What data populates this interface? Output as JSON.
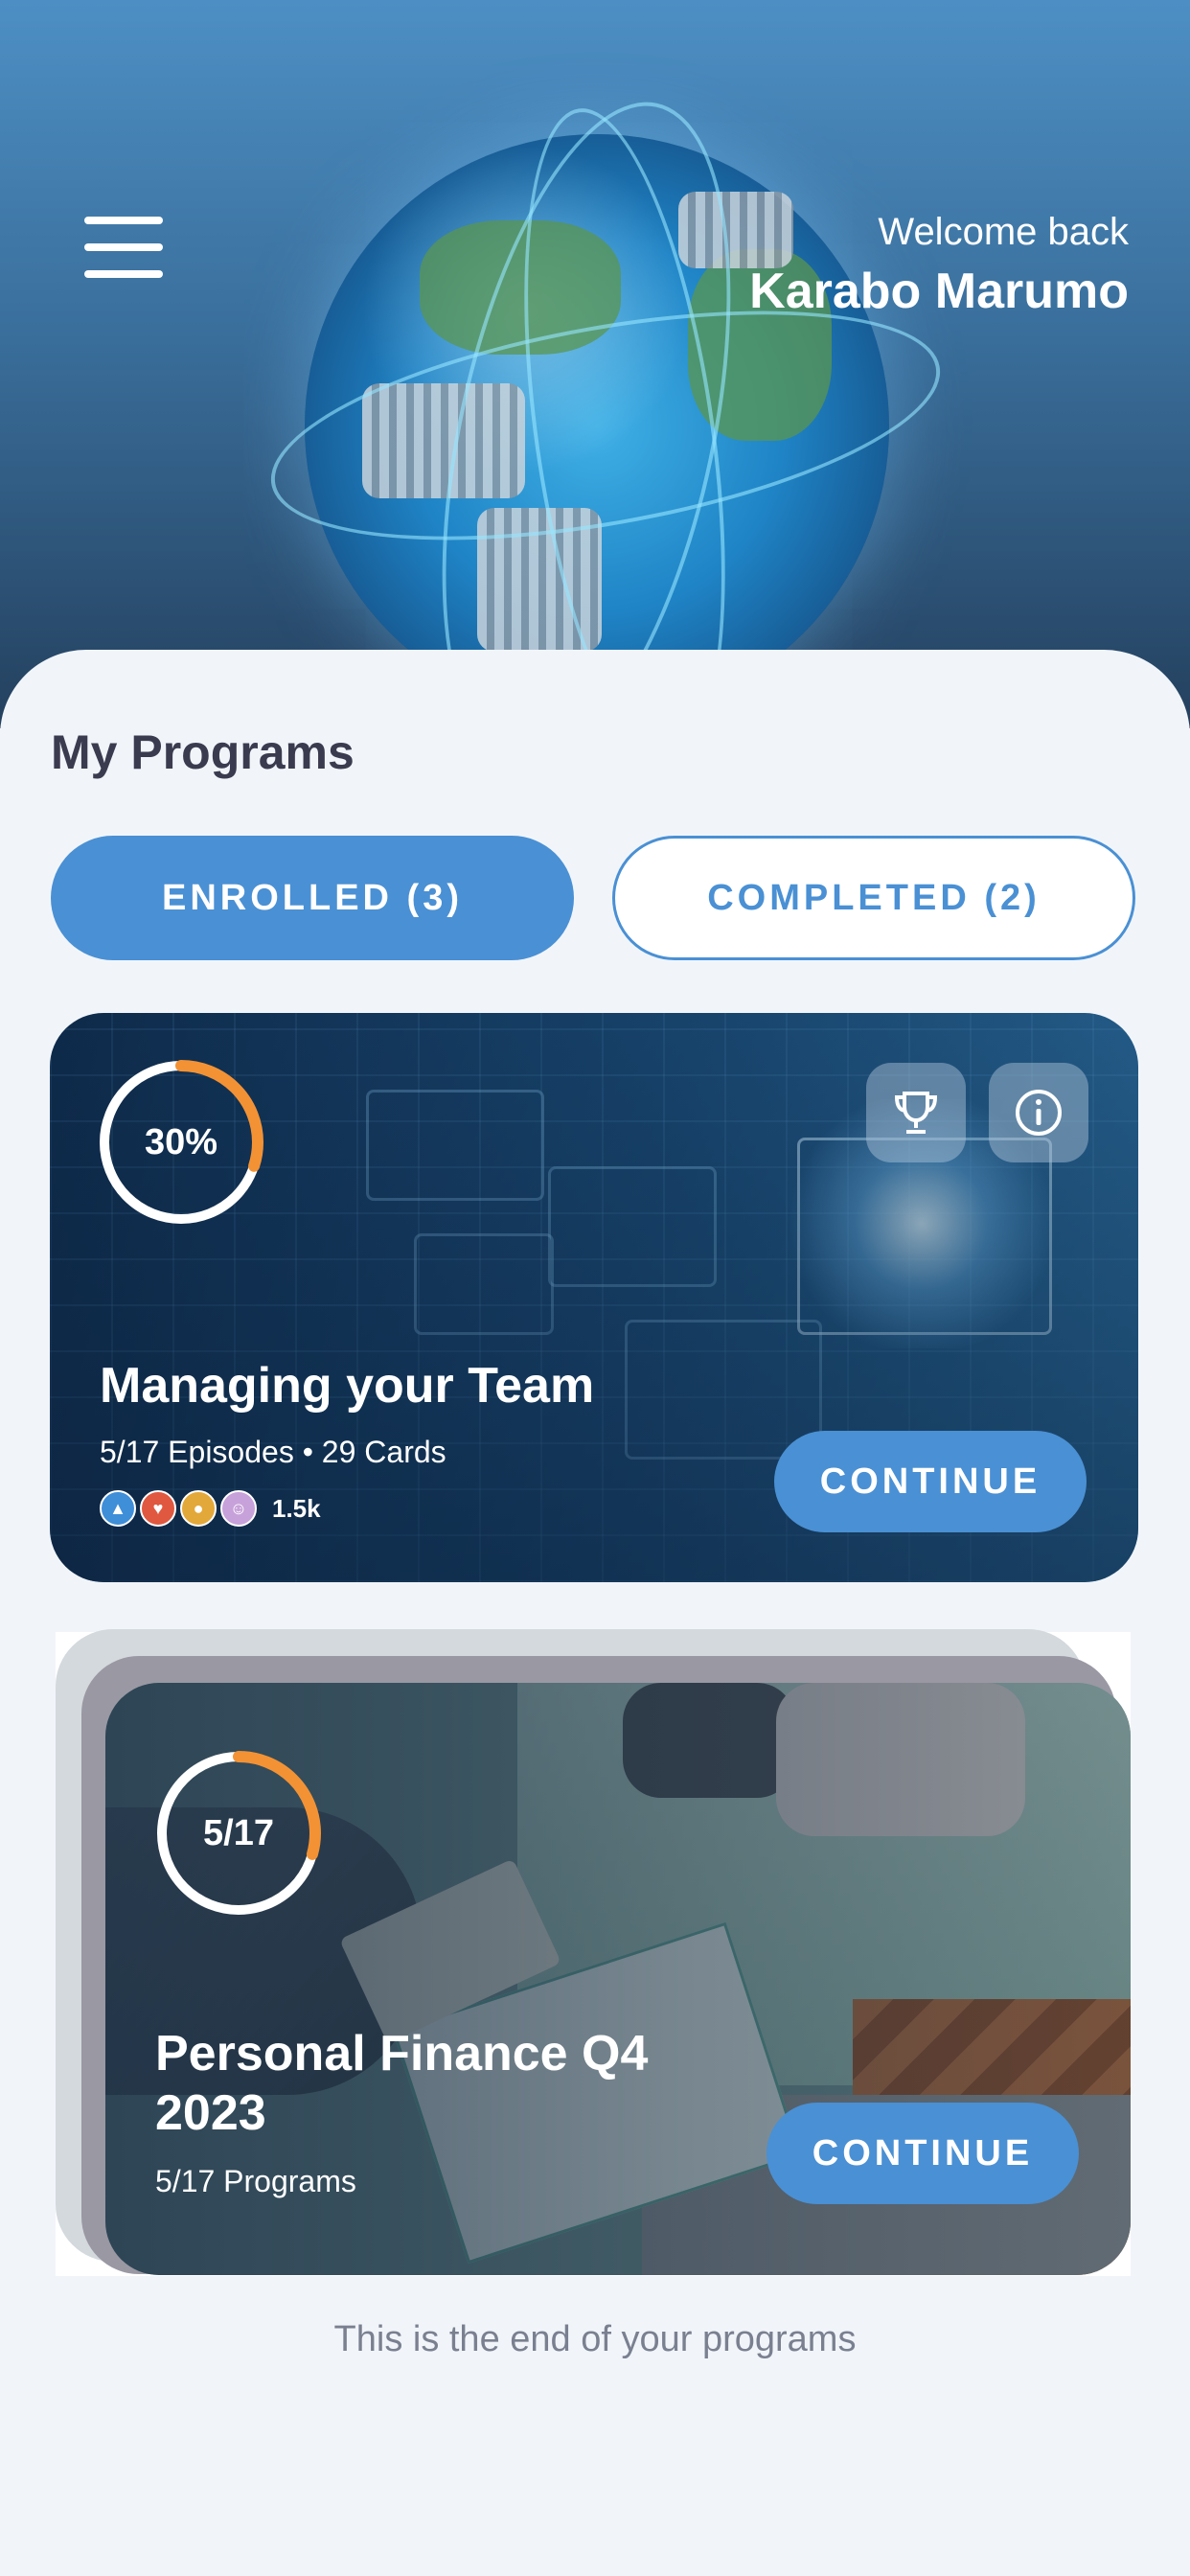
{
  "header": {
    "welcome_label": "Welcome back",
    "user_name": "Karabo Marumo"
  },
  "section_title": "My Programs",
  "tabs": [
    {
      "label": "ENROLLED (3)",
      "active": true
    },
    {
      "label": "COMPLETED (2)",
      "active": false
    }
  ],
  "programs": [
    {
      "progress_label": "30%",
      "progress_fraction": 0.3,
      "title": "Managing your Team",
      "meta": "5/17 Episodes • 29 Cards",
      "reactions": [
        "thumbs-up-icon",
        "heart-icon",
        "lightbulb-icon",
        "laugh-icon"
      ],
      "reaction_count": "1.5k",
      "continue_label": "CONTINUE"
    },
    {
      "progress_label": "5/17",
      "progress_fraction": 0.294,
      "title": "Personal Finance Q4 2023",
      "meta": "5/17 Programs",
      "continue_label": "CONTINUE"
    }
  ],
  "footer_note": "This is the end of your programs",
  "colors": {
    "accent": "#4a90d4",
    "progress": "#f39234",
    "title_text": "#3b3b4f"
  }
}
